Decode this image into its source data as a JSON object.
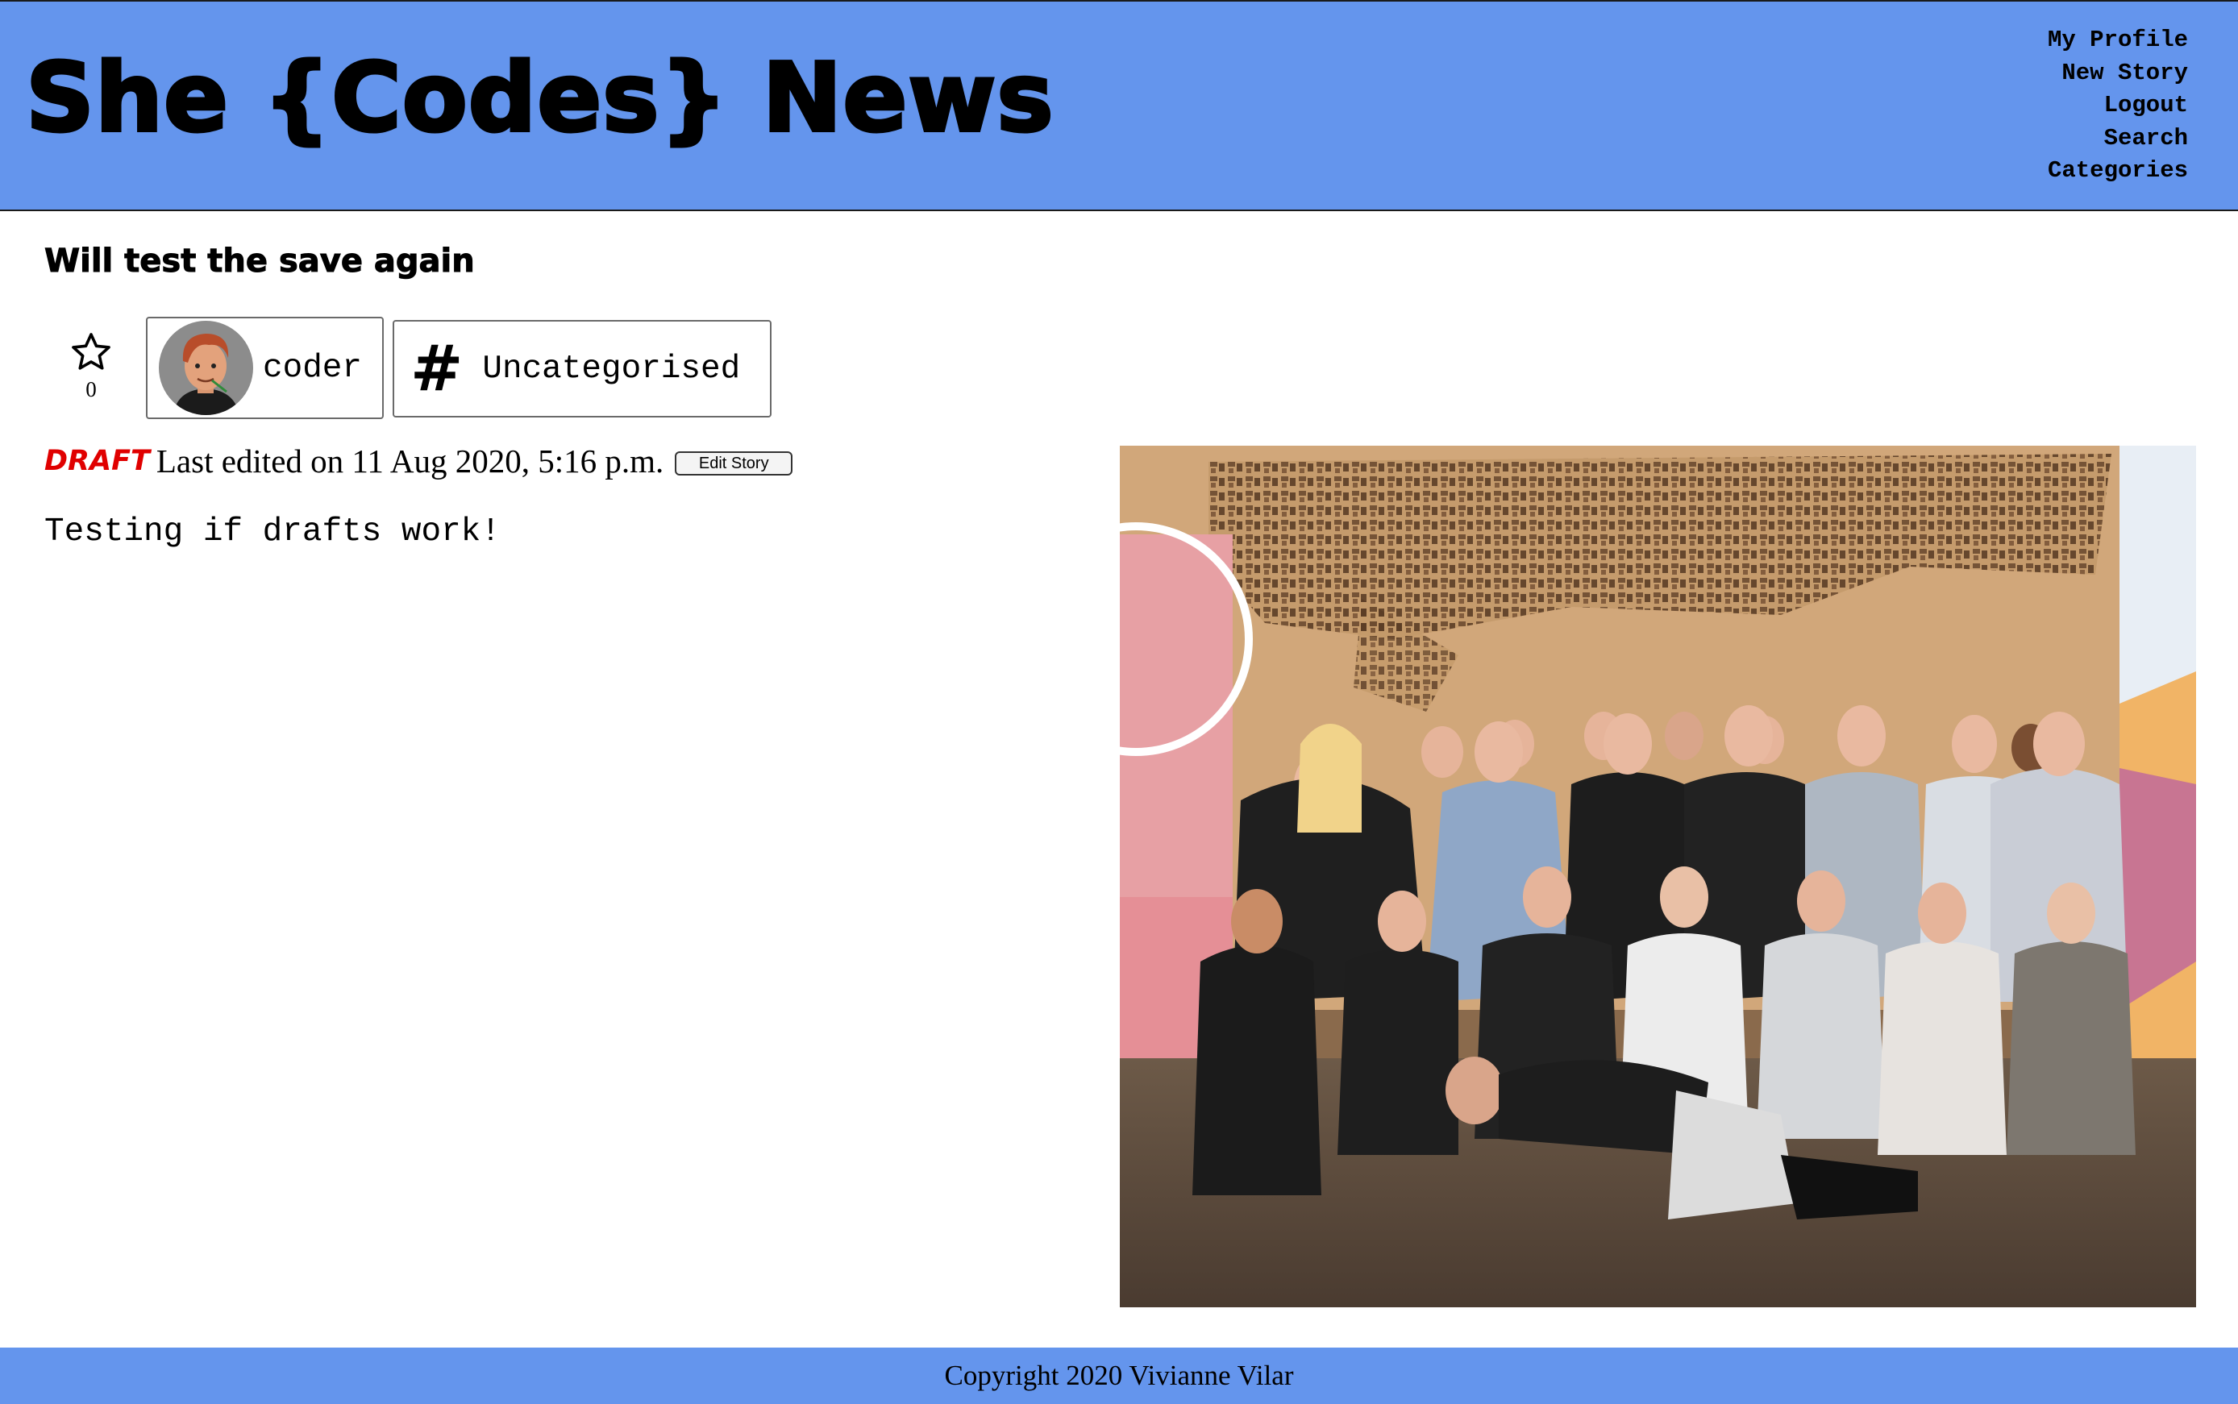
{
  "header": {
    "site_title": "She {Codes} News",
    "nav": [
      "My Profile",
      "New Story",
      "Logout",
      "Search",
      "Categories"
    ]
  },
  "story": {
    "title": "Will test the save again",
    "favourite_count": "0",
    "author": "coder",
    "category": "Uncategorised",
    "category_icon": "hash-icon",
    "status": "DRAFT",
    "last_edited": "Last edited on 11 Aug 2020, 5:16 p.m.",
    "edit_label": "Edit Story",
    "body": "Testing if drafts work!"
  },
  "footer": {
    "copyright": "Copyright 2020 Vivianne Vilar"
  },
  "colors": {
    "header_bg": "#6495ed",
    "draft": "#e00000"
  }
}
